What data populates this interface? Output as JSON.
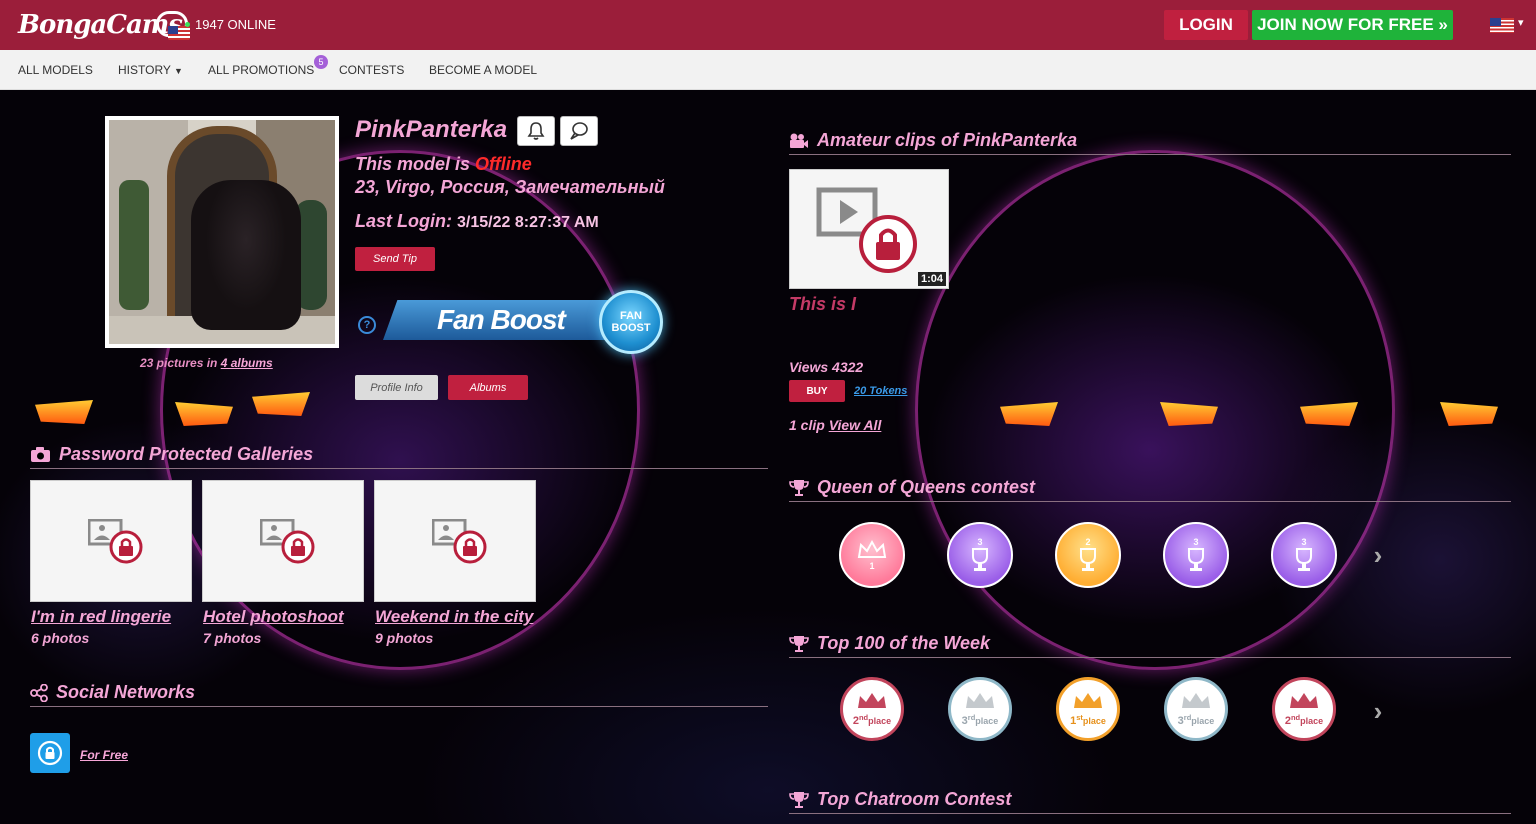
{
  "header": {
    "logo": "BongaCams",
    "online_count": "1947 ONLINE",
    "login": "LOGIN",
    "join": "JOIN NOW FOR FREE »",
    "flag": "us-flag-icon"
  },
  "nav": {
    "items": [
      "ALL MODELS",
      "HISTORY",
      "ALL PROMOTIONS",
      "CONTESTS",
      "BECOME A MODEL"
    ],
    "promotions_badge": "5"
  },
  "profile": {
    "name": "PinkPanterka",
    "status_prefix": "This model is ",
    "status": "Offline",
    "details": "23, Virgo, Россия, Замечательный",
    "last_login_label": "Last Login:",
    "last_login": "3/15/22 8:27:37 AM",
    "send_tip": "Send Tip",
    "pictures_prefix": "23 pictures in ",
    "albums_link": "4 albums",
    "fanboost_label": "Fan Boost",
    "fanboost_badge_1": "FAN",
    "fanboost_badge_2": "BOOST",
    "help": "?",
    "tab_profile": "Profile Info",
    "tab_albums": "Albums"
  },
  "galleries": {
    "title": "Password Protected Galleries",
    "items": [
      {
        "title": "I'm in red lingerie",
        "count": "6 photos"
      },
      {
        "title": "Hotel photoshoot",
        "count": "7 photos"
      },
      {
        "title": "Weekend in the city",
        "count": "9 photos"
      }
    ]
  },
  "social": {
    "title": "Social Networks",
    "link": "For Free"
  },
  "clips": {
    "title": "Amateur clips of PinkPanterka",
    "duration": "1:04",
    "clip_title": "This is I",
    "views": "Views 4322",
    "buy": "BUY",
    "tokens": "20 Tokens",
    "count_prefix": "1 clip ",
    "view_all": "View All"
  },
  "contests": {
    "queen_title": "Queen of Queens contest",
    "queen_awards": [
      "1",
      "3",
      "2",
      "3",
      "3"
    ],
    "top100_title": "Top 100 of the Week",
    "top100_awards": [
      {
        "num": "2",
        "suffix": "nd",
        "word": "place"
      },
      {
        "num": "3",
        "suffix": "rd",
        "word": "place"
      },
      {
        "num": "1",
        "suffix": "st",
        "word": "place"
      },
      {
        "num": "3",
        "suffix": "rd",
        "word": "place"
      },
      {
        "num": "2",
        "suffix": "nd",
        "word": "place"
      }
    ],
    "chatroom_title": "Top Chatroom Contest"
  },
  "colors": {
    "header_bg": "#9b1e3a",
    "accent_pink": "#f4a6d6",
    "offline_red": "#ff2a2a",
    "button_red": "#c0203f",
    "join_green": "#1fb33a",
    "link_blue": "#3a9ae8"
  }
}
